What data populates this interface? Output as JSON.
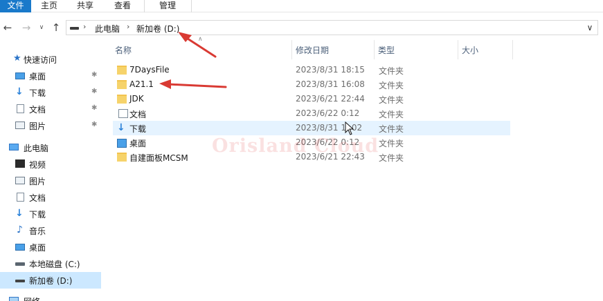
{
  "ribbon": {
    "tabs": [
      {
        "label": "文件"
      },
      {
        "label": "主页"
      },
      {
        "label": "共享"
      },
      {
        "label": "查看"
      },
      {
        "label": "管理"
      }
    ]
  },
  "address_bar": {
    "crumbs": [
      "此电脑",
      "新加卷 (D:)"
    ]
  },
  "sidebar": {
    "items": [
      {
        "label": "快速访问",
        "icon": "quick-access-star-icon"
      },
      {
        "label": "桌面",
        "icon": "desktop-icon",
        "pinned": true
      },
      {
        "label": "下载",
        "icon": "download-arrow-icon",
        "pinned": true
      },
      {
        "label": "文档",
        "icon": "document-icon",
        "pinned": true
      },
      {
        "label": "图片",
        "icon": "picture-icon",
        "pinned": true
      },
      {
        "label": "此电脑",
        "icon": "this-pc-icon"
      },
      {
        "label": "视频",
        "icon": "video-icon"
      },
      {
        "label": "图片",
        "icon": "picture-icon"
      },
      {
        "label": "文档",
        "icon": "document-icon"
      },
      {
        "label": "下载",
        "icon": "download-arrow-icon"
      },
      {
        "label": "音乐",
        "icon": "music-note-icon"
      },
      {
        "label": "桌面",
        "icon": "desktop-icon"
      },
      {
        "label": "本地磁盘 (C:)",
        "icon": "local-disk-icon"
      },
      {
        "label": "新加卷 (D:)",
        "icon": "drive-icon",
        "selected": true
      },
      {
        "label": "网络",
        "icon": "network-icon"
      }
    ]
  },
  "columns": {
    "name": "名称",
    "date": "修改日期",
    "type": "类型",
    "size": "大小"
  },
  "files": [
    {
      "name": "7DaysFile",
      "date": "2023/8/31 18:15",
      "type": "文件夹",
      "icon": "folder-icon"
    },
    {
      "name": "A21.1",
      "date": "2023/8/31 16:08",
      "type": "文件夹",
      "icon": "folder-icon"
    },
    {
      "name": "JDK",
      "date": "2023/6/21 22:44",
      "type": "文件夹",
      "icon": "folder-icon"
    },
    {
      "name": "文档",
      "date": "2023/6/22 0:12",
      "type": "文件夹",
      "icon": "document-icon"
    },
    {
      "name": "下载",
      "date": "2023/8/31 1 :02",
      "type": "文件夹",
      "icon": "download-arrow-icon",
      "hovered": true
    },
    {
      "name": "桌面",
      "date": "2023/6/22 0:12",
      "type": "文件夹",
      "icon": "desktop-icon"
    },
    {
      "name": "自建面板MCSM",
      "date": "2023/6/21 22:43",
      "type": "文件夹",
      "icon": "folder-icon"
    }
  ],
  "watermark": "Orisland Cloud",
  "colors": {
    "file_tab": "#1979ca",
    "selected_nav": "#cce8ff",
    "hover_row": "#e5f3ff",
    "annotation_arrow": "#d93a33",
    "folder": "#f6d36b"
  }
}
